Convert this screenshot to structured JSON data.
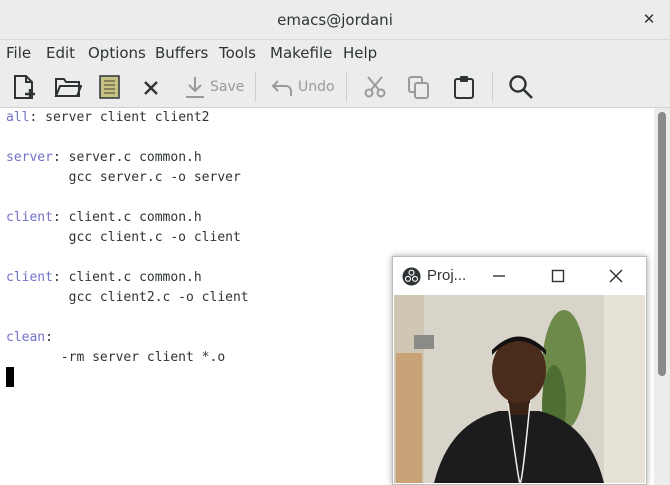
{
  "window": {
    "title": "emacs@jordani"
  },
  "menu": [
    "File",
    "Edit",
    "Options",
    "Buffers",
    "Tools",
    "Makefile",
    "Help"
  ],
  "toolbar": {
    "new_file": "new-file-icon",
    "open": "open-folder-icon",
    "dired": "dired-icon",
    "kill_buffer": "close-icon",
    "save_label": "Save",
    "undo_label": "Undo",
    "cut": "cut-icon",
    "copy": "copy-icon",
    "paste": "paste-icon",
    "search": "search-icon"
  },
  "editor": {
    "lines": [
      {
        "target": "all",
        "rest": " server client client2"
      },
      {
        "target": "",
        "rest": ""
      },
      {
        "target": "server",
        "rest": " server.c common.h"
      },
      {
        "target": "",
        "rest": "        gcc server.c -o server"
      },
      {
        "target": "",
        "rest": ""
      },
      {
        "target": "client",
        "rest": " client.c common.h"
      },
      {
        "target": "",
        "rest": "        gcc client.c -o client"
      },
      {
        "target": "",
        "rest": ""
      },
      {
        "target": "client",
        "rest": " client.c common.h"
      },
      {
        "target": "",
        "rest": "        gcc client2.c -o client"
      },
      {
        "target": "",
        "rest": ""
      },
      {
        "target": "clean",
        "rest": ""
      },
      {
        "target": "",
        "rest": "       -rm server client *.o"
      }
    ]
  },
  "camera_window": {
    "title": "Proj...",
    "minimize": "minimize-icon",
    "maximize": "maximize-icon",
    "close": "close-icon"
  },
  "colors": {
    "keyword": "#7272c8",
    "chrome": "#ececec",
    "disabled": "#9a9a9a"
  }
}
